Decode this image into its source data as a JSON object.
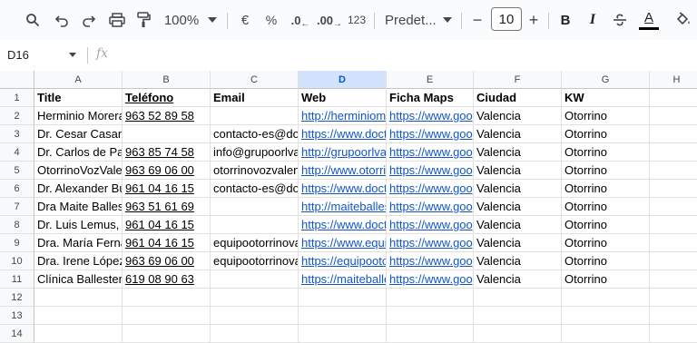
{
  "toolbar": {
    "zoom": "100%",
    "currency": "€",
    "percent": "%",
    "dec_decrease": ".0",
    "dec_increase": ".00",
    "number_format": "123",
    "font_name": "Predet...",
    "font_size": "10",
    "bold": "B",
    "italic": "I",
    "text_color_letter": "A",
    "minus": "−",
    "plus": "+"
  },
  "formula_bar": {
    "cell_ref": "D16",
    "fx": "fx"
  },
  "columns": [
    "A",
    "B",
    "C",
    "D",
    "E",
    "F",
    "G",
    "H"
  ],
  "rows": [
    "1",
    "2",
    "3",
    "4",
    "5",
    "6",
    "7",
    "8",
    "9",
    "10",
    "11",
    "12",
    "13",
    "14"
  ],
  "headers": [
    "Title",
    "Teléfono",
    "Email",
    "Web",
    "Ficha Maps",
    "Ciudad",
    "KW"
  ],
  "data": [
    [
      "Herminio Morera",
      " 963 52 89 58",
      "",
      "http://herminiomorera.com",
      "https://www.google.com",
      "Valencia",
      "Otorrino"
    ],
    [
      "Dr. Cesar Casanova",
      "",
      "contacto-es@doctoralia.es",
      "https://www.doctoralia.es",
      "https://www.google.com",
      "Valencia",
      "Otorrino"
    ],
    [
      "Dr. Carlos de Paula",
      " 963 85 74 58",
      "info@grupoorlvalencia.com",
      "http://grupoorlvalencia.com",
      "https://www.google.com",
      "Valencia",
      "Otorrino"
    ],
    [
      "OtorrinoVozValencia",
      " 963 69 06 00",
      "otorrinovozvalencia@gmail.com",
      "http://www.otorrinovoz.com",
      "https://www.google.com",
      "Valencia",
      "Otorrino"
    ],
    [
      "Dr. Alexander Bustos",
      " 961 04 16 15",
      "contacto-es@doctoralia.es",
      "https://www.doctoralia.es",
      "https://www.google.com",
      "Valencia",
      "Otorrino"
    ],
    [
      "Dra Maite Ballester",
      " 963 51 61 69",
      "",
      "http://maiteballester.com",
      "https://www.google.com",
      "Valencia",
      "Otorrino"
    ],
    [
      "Dr. Luis Lemus, ",
      " 961 04 16 15",
      "",
      "https://www.doctoralia.es",
      "https://www.google.com",
      "Valencia",
      "Otorrino"
    ],
    [
      "Dra. María Fernández",
      " 961 04 16 15",
      "equipootorrinovalencia@gmail.com",
      "https://www.equipootorrino.es",
      "https://www.google.com",
      "Valencia",
      "Otorrino"
    ],
    [
      "Dra. Irene López",
      " 963 69 06 00",
      "equipootorrinovalencia@gmail.com",
      "https://equipootorrino.es",
      "https://www.google.com",
      "Valencia",
      "Otorrino"
    ],
    [
      "Clínica Ballester",
      " 619 08 90 63",
      "",
      "https://maiteballester.com",
      "https://www.google.com",
      "Valencia",
      "Otorrino"
    ]
  ],
  "colors": {
    "link": "#1155cc",
    "selected_header_bg": "#d3e3fd",
    "selected_header_text": "#0b57d0",
    "toolbar_bg": "#f9fbfd"
  }
}
